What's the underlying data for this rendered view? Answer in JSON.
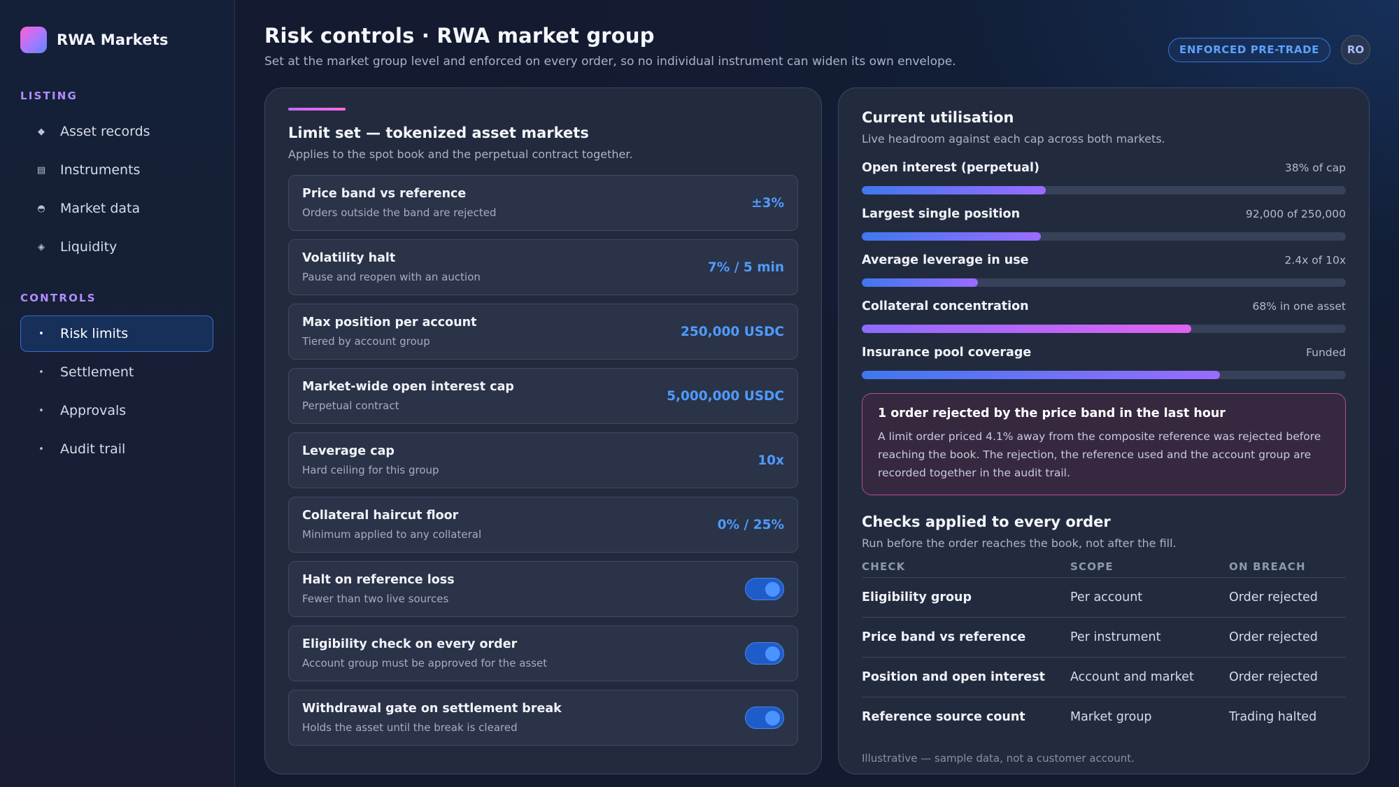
{
  "brand": {
    "name": "RWA Markets"
  },
  "sidebar": {
    "sections": [
      {
        "title": "LISTING",
        "items": [
          {
            "label": "Asset records",
            "icon": "diamond-icon"
          },
          {
            "label": "Instruments",
            "icon": "list-icon"
          },
          {
            "label": "Market data",
            "icon": "half-circle-icon"
          },
          {
            "label": "Liquidity",
            "icon": "diamond-outline-icon"
          }
        ]
      },
      {
        "title": "CONTROLS",
        "items": [
          {
            "label": "Risk limits",
            "icon": "dot-icon",
            "active": true
          },
          {
            "label": "Settlement",
            "icon": "dot-icon"
          },
          {
            "label": "Approvals",
            "icon": "dot-icon"
          },
          {
            "label": "Audit trail",
            "icon": "dot-icon"
          }
        ]
      }
    ]
  },
  "header": {
    "title": "Risk controls · RWA market group",
    "subtitle": "Set at the market group level and enforced on every order, so no individual instrument can widen its own envelope.",
    "badge": "ENFORCED PRE-TRADE",
    "avatar": "RO"
  },
  "limit_set": {
    "title": "Limit set — tokenized asset markets",
    "subtitle": "Applies to the spot book and the perpetual contract together.",
    "rows": [
      {
        "name": "Price band vs reference",
        "desc": "Orders outside the band are rejected",
        "value": "±3%"
      },
      {
        "name": "Volatility halt",
        "desc": "Pause and reopen with an auction",
        "value": "7% / 5 min"
      },
      {
        "name": "Max position per account",
        "desc": "Tiered by account group",
        "value": "250,000 USDC"
      },
      {
        "name": "Market-wide open interest cap",
        "desc": "Perpetual contract",
        "value": "5,000,000 USDC"
      },
      {
        "name": "Leverage cap",
        "desc": "Hard ceiling for this group",
        "value": "10x"
      },
      {
        "name": "Collateral haircut floor",
        "desc": "Minimum applied to any collateral",
        "value": "0% / 25%"
      },
      {
        "name": "Halt on reference loss",
        "desc": "Fewer than two live sources",
        "toggle": true
      },
      {
        "name": "Eligibility check on every order",
        "desc": "Account group must be approved for the asset",
        "toggle": true
      },
      {
        "name": "Withdrawal gate on settlement break",
        "desc": "Holds the asset until the break is cleared",
        "toggle": true
      }
    ]
  },
  "utilisation": {
    "title": "Current utilisation",
    "subtitle": "Live headroom against each cap across both markets.",
    "rows": [
      {
        "name": "Open interest (perpetual)",
        "value": "38% of cap",
        "fill": 0.38,
        "gradient": [
          "#3f78ee",
          "#9a6cff"
        ]
      },
      {
        "name": "Largest single position",
        "value": "92,000 of 250,000",
        "fill": 0.37,
        "gradient": [
          "#3f78ee",
          "#9a6cff"
        ]
      },
      {
        "name": "Average leverage in use",
        "value": "2.4x of 10x",
        "fill": 0.24,
        "gradient": [
          "#3f78ee",
          "#9a6cff"
        ]
      },
      {
        "name": "Collateral concentration",
        "value": "68% in one asset",
        "fill": 0.68,
        "gradient": [
          "#8c6cff",
          "#e062f0"
        ]
      },
      {
        "name": "Insurance pool coverage",
        "value": "Funded",
        "fill": 0.74,
        "gradient": [
          "#3f78ee",
          "#9a6cff"
        ]
      }
    ]
  },
  "alert": {
    "title": "1 order rejected by the price band in the last hour",
    "body": "A limit order priced 4.1% away from the composite reference was rejected before reaching the book. The rejection, the reference used and the account group are recorded together in the audit trail."
  },
  "checks": {
    "title": "Checks applied to every order",
    "subtitle": "Run before the order reaches the book, not after the fill.",
    "columns": [
      "CHECK",
      "SCOPE",
      "ON BREACH"
    ],
    "rows": [
      [
        "Eligibility group",
        "Per account",
        "Order rejected"
      ],
      [
        "Price band vs reference",
        "Per instrument",
        "Order rejected"
      ],
      [
        "Position and open interest",
        "Account and market",
        "Order rejected"
      ],
      [
        "Reference source count",
        "Market group",
        "Trading halted"
      ]
    ],
    "footnote": "Illustrative — sample data, not a customer account."
  },
  "colors": {
    "accent_blue": "#4f9bff",
    "active_nav_border": "#3a6bd1",
    "section_label": "#b48cff",
    "alert_border": "#b54b96"
  }
}
